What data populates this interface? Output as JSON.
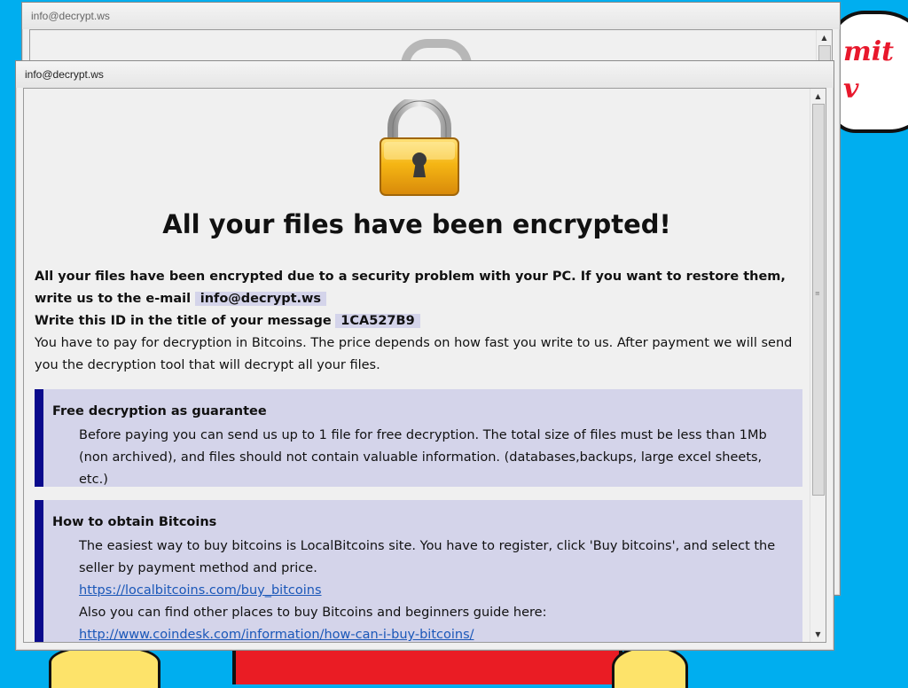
{
  "wallpaper": {
    "bubble_text": "mit\nv"
  },
  "back_window": {
    "title": "info@decrypt.ws"
  },
  "front_window": {
    "title": "info@decrypt.ws",
    "headline": "All your files have been encrypted!",
    "intro_bold_1": "All your files have been encrypted due to a security problem with your PC. If you want to restore them, write us to the e-mail",
    "email": "info@decrypt.ws",
    "id_label": "Write this ID in the title of your message",
    "id_value": "1CA527B9",
    "payment_text": "You have to pay for decryption in Bitcoins. The price depends on how fast you write to us. After payment we will send you the decryption tool that will decrypt all your files.",
    "panels": [
      {
        "title": "Free decryption as guarantee",
        "body": "Before paying you can send us up to 1 file for free decryption. The total size of files must be less than 1Mb (non archived), and files should not contain valuable information. (databases,backups, large excel sheets, etc.)"
      },
      {
        "title": "How to obtain Bitcoins",
        "body_1": "The easiest way to buy bitcoins is LocalBitcoins site. You have to register, click 'Buy bitcoins', and select the seller by payment method and price.",
        "link_1": "https://localbitcoins.com/buy_bitcoins",
        "body_2": "Also you can find other places to buy Bitcoins and beginners guide here:",
        "link_2": "http://www.coindesk.com/information/how-can-i-buy-bitcoins/"
      }
    ]
  },
  "colors": {
    "desktop": "#00aeef",
    "panel_bg": "#d4d4ea",
    "panel_accent": "#0a0a8c",
    "link": "#1a57b8"
  },
  "icons": [
    "padlock-icon",
    "scroll-up-icon",
    "scroll-down-icon"
  ]
}
